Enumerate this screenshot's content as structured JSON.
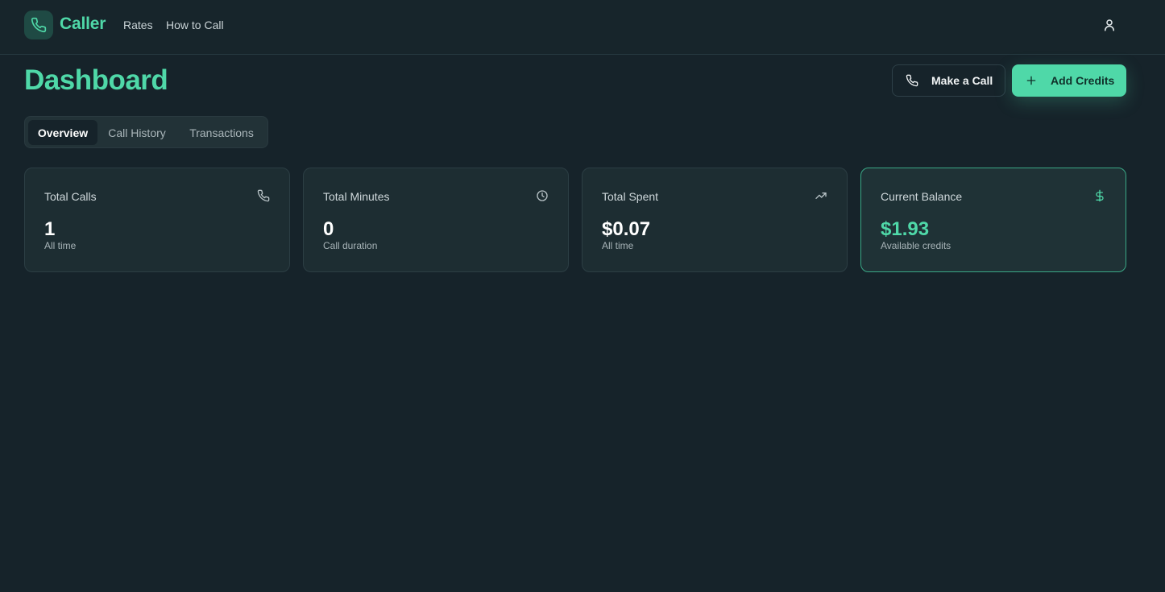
{
  "header": {
    "brand": "Caller",
    "nav": [
      "Rates",
      "How to Call"
    ],
    "icons": {
      "logo": "phone-icon",
      "user": "user-icon"
    }
  },
  "page": {
    "title": "Dashboard",
    "actions": {
      "make_call": "Make a Call",
      "add_credits": "Add Credits"
    }
  },
  "tabs": [
    {
      "label": "Overview",
      "active": true
    },
    {
      "label": "Call History",
      "active": false
    },
    {
      "label": "Transactions",
      "active": false
    }
  ],
  "stats": [
    {
      "label": "Total Calls",
      "value": "1",
      "sub": "All time",
      "icon": "phone-icon"
    },
    {
      "label": "Total Minutes",
      "value": "0",
      "sub": "Call duration",
      "icon": "clock-icon"
    },
    {
      "label": "Total Spent",
      "value": "$0.07",
      "sub": "All time",
      "icon": "trending-up-icon"
    },
    {
      "label": "Current Balance",
      "value": "$1.93",
      "sub": "Available credits",
      "icon": "dollar-icon"
    }
  ],
  "colors": {
    "accent": "#4fd8a8",
    "background": "#16232a",
    "card": "#1d2d32"
  }
}
